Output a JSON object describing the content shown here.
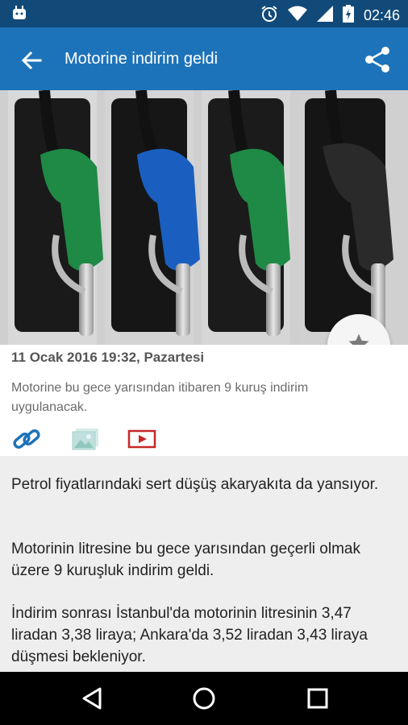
{
  "status_bar": {
    "time": "02:46",
    "icons": [
      "android-icon",
      "alarm-icon",
      "wifi-icon",
      "signal-icon",
      "battery-icon"
    ]
  },
  "app_bar": {
    "title": "Motorine indirim geldi",
    "back_icon": "arrow-back-icon",
    "share_icon": "share-icon",
    "color": "#1d73b9",
    "status_color": "#114a79"
  },
  "article": {
    "date": "11 Ocak 2016 19:32, Pazartesi",
    "summary": "Motorine bu gece yarısından itibaren 9 kuruş indirim uygulanacak.",
    "actions": [
      "link-icon",
      "image-gallery-icon",
      "youtube-icon"
    ],
    "favorite_icon": "star-icon",
    "paragraphs": [
      "Petrol fiyatlarındaki sert düşüş akaryakıta da yansıyor.",
      "Motorinin litresine bu gece yarısından geçerli olmak üzere 9 kuruşluk indirim geldi.",
      "İndirim sonrası İstanbul'da motorinin litresinin 3,47 liradan 3,38 liraya; Ankara'da 3,52 liradan 3,43 liraya düşmesi bekleniyor."
    ]
  },
  "nav_bar": {
    "buttons": [
      "back-triangle-icon",
      "home-circle-icon",
      "recents-square-icon"
    ]
  }
}
